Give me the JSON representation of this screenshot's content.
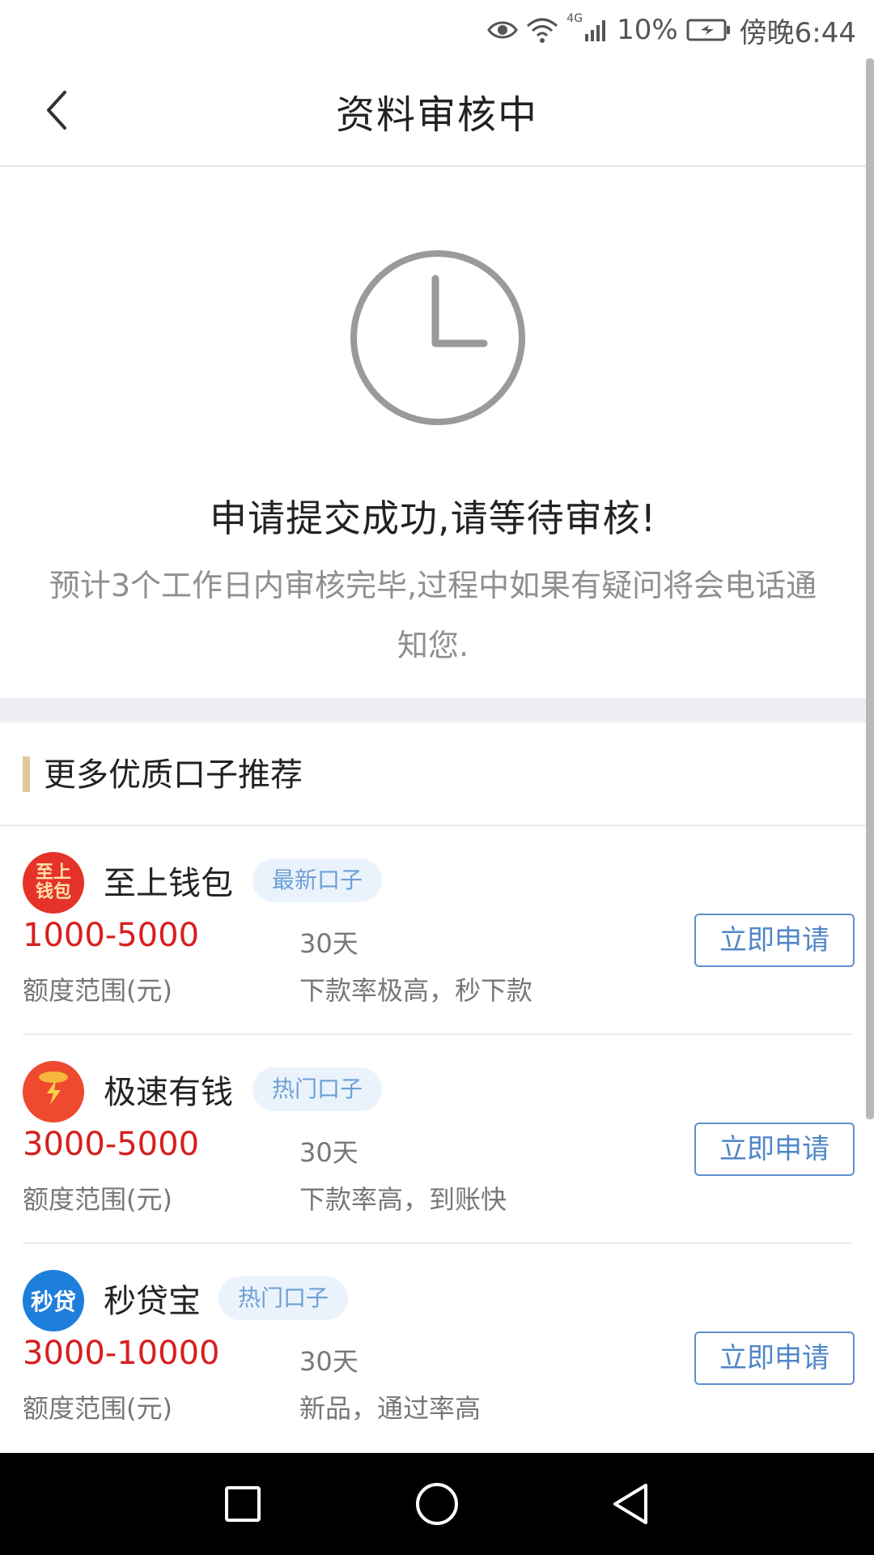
{
  "status_bar": {
    "battery_percent": "10%",
    "time": "傍晚6:44",
    "network_label": "4G",
    "icons": [
      "eye-icon",
      "wifi-icon",
      "signal-icon",
      "battery-icon"
    ]
  },
  "header": {
    "title": "资料审核中",
    "back_icon": "chevron-left-icon"
  },
  "status": {
    "icon": "clock-icon",
    "message": "申请提交成功,请等待审核!",
    "sub_message": "预计3个工作日内审核完毕,过程中如果有疑问将会电话通知您."
  },
  "recommend": {
    "title": "更多优质口子推荐",
    "items": [
      {
        "name": "至上钱包",
        "tag": "最新口子",
        "amount": "1000-5000",
        "amount_label": "额度范围(元)",
        "term": "30天",
        "desc": "下款率极高，秒下款",
        "apply_label": "立即申请",
        "logo_text": "至上钱包",
        "logo_color": "#e5332a"
      },
      {
        "name": "极速有钱",
        "tag": "热门口子",
        "amount": "3000-5000",
        "amount_label": "额度范围(元)",
        "term": "30天",
        "desc": "下款率高，到账快",
        "apply_label": "立即申请",
        "logo_text": "",
        "logo_color": "#ef4a2f"
      },
      {
        "name": "秒贷宝",
        "tag": "热门口子",
        "amount": "3000-10000",
        "amount_label": "额度范围(元)",
        "term": "30天",
        "desc": "新品，通过率高",
        "apply_label": "立即申请",
        "logo_text": "秒贷",
        "logo_color": "#1e7fdb"
      }
    ]
  },
  "colors": {
    "accent_red": "#d81e1e",
    "button_blue": "#4f86c8",
    "tag_blue": "#6d9fd5",
    "section_bar": "#dfc79a"
  },
  "system_nav": {
    "icons": [
      "square-recent-icon",
      "circle-home-icon",
      "triangle-back-icon"
    ]
  }
}
